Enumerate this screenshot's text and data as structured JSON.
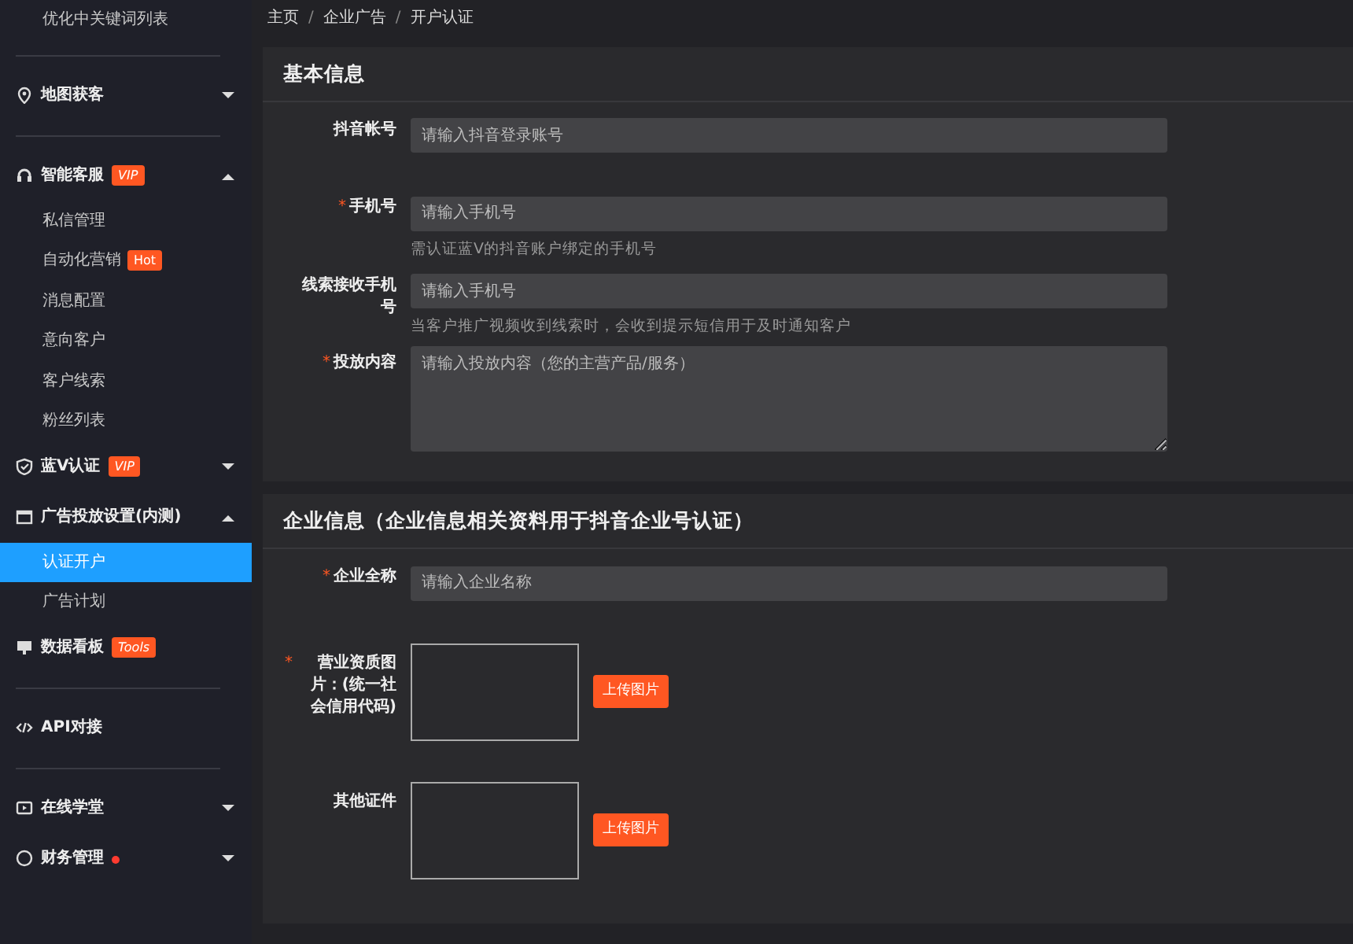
{
  "sidebar": {
    "items": [
      {
        "kind": "sub",
        "label": "优化中关键词列表",
        "selected": false
      },
      {
        "kind": "divider"
      },
      {
        "kind": "group",
        "label": "地图获客",
        "expanded": false
      },
      {
        "kind": "divider"
      },
      {
        "kind": "group",
        "label": "智能客服",
        "badge": "VIP",
        "expanded": true
      },
      {
        "kind": "sub",
        "label": "私信管理",
        "selected": false
      },
      {
        "kind": "sub",
        "label": "自动化营销",
        "badge": "Hot",
        "selected": false
      },
      {
        "kind": "sub",
        "label": "消息配置",
        "selected": false
      },
      {
        "kind": "sub",
        "label": "意向客户",
        "selected": false
      },
      {
        "kind": "sub",
        "label": "客户线索",
        "selected": false
      },
      {
        "kind": "sub",
        "label": "粉丝列表",
        "selected": false
      },
      {
        "kind": "group",
        "label": "蓝V认证",
        "badge": "VIP",
        "expanded": false
      },
      {
        "kind": "group",
        "label": "广告投放设置(内测)",
        "expanded": true
      },
      {
        "kind": "sub",
        "label": "认证开户",
        "selected": true
      },
      {
        "kind": "sub",
        "label": "广告计划",
        "selected": false
      },
      {
        "kind": "link",
        "label": "数据看板",
        "badge": "Tools"
      },
      {
        "kind": "divider"
      },
      {
        "kind": "link",
        "label": "API对接"
      },
      {
        "kind": "divider"
      },
      {
        "kind": "group",
        "label": "在线学堂",
        "expanded": false
      },
      {
        "kind": "group",
        "label": "财务管理",
        "dot": true,
        "expanded": false
      }
    ]
  },
  "breadcrumb": {
    "items": [
      "主页",
      "企业广告",
      "开户认证"
    ],
    "separators": [
      "/",
      "/"
    ]
  },
  "sections": [
    {
      "title": "基本信息",
      "fields": [
        {
          "kind": "input",
          "label": "抖音帐号",
          "placeholder": "请输入抖音登录账号"
        },
        {
          "kind": "input",
          "label": "手机号",
          "required_mark": "*",
          "placeholder": "请输入手机号",
          "hint": "需认证蓝V的抖音账户绑定的手机号"
        },
        {
          "kind": "input",
          "label": "线索接收手机号",
          "placeholder": "请输入手机号",
          "hint": "当客户推广视频收到线索时，会收到提示短信用于及时通知客户"
        },
        {
          "kind": "textarea",
          "label": "投放内容",
          "required_mark": "*",
          "placeholder": "请输入投放内容（您的主营产品/服务）"
        }
      ]
    },
    {
      "title": "企业信息（企业信息相关资料用于抖音企业号认证）",
      "fields": [
        {
          "kind": "input",
          "label": "企业全称",
          "required_mark": "*",
          "placeholder": "请输入企业名称"
        },
        {
          "kind": "upload",
          "label": "营业资质图片：(统一社会信用代码)",
          "required_mark": "*",
          "button": "上传图片"
        },
        {
          "kind": "upload",
          "label": "其他证件",
          "button": "上传图片"
        }
      ]
    }
  ]
}
